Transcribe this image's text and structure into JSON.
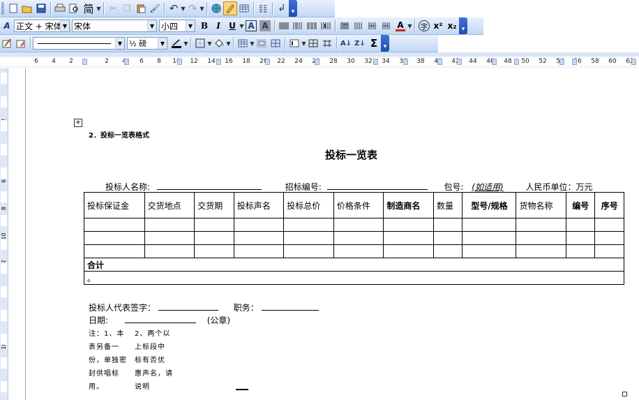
{
  "toolbar1": {
    "buttons": [
      "new-icon",
      "open-icon",
      "save-icon",
      "print-icon",
      "preview-icon"
    ],
    "simplified_label": "简",
    "hyperlink": "hyperlink-icon"
  },
  "toolbar2": {
    "style_value": "正文 + 宋体",
    "font_value": "宋体",
    "size_value": "小四",
    "bold": "B",
    "italic": "I",
    "underline": "U",
    "char_border": "A",
    "char_shading": "A",
    "font_color": "A",
    "enclose": "字",
    "superscript": "x²",
    "subscript": "x₂"
  },
  "toolbar3": {
    "line_weight_value": "½ 磅",
    "sum_label": "Σ"
  },
  "ruler": {
    "labels": [
      "6",
      "4",
      "2",
      "2",
      "4",
      "6",
      "8",
      "10",
      "12",
      "14",
      "16",
      "18",
      "20",
      "22",
      "24",
      "26",
      "28",
      "30",
      "32",
      "34",
      "36",
      "38",
      "40",
      "42",
      "44",
      "46",
      "48",
      "50",
      "52",
      "54",
      "56",
      "58",
      "60",
      "62"
    ],
    "vlabels": [
      "4",
      "2",
      "2",
      "4",
      "6",
      "8",
      "10",
      "12",
      "14",
      "16",
      "18"
    ]
  },
  "doc": {
    "section_heading": "2．投标一览表格式",
    "title": "投标一览表",
    "bidder_name_label": "投标人名称:",
    "tender_no_label": "招标编号:",
    "package_label": "包号:",
    "package_hint": "(如适用)",
    "currency_label": "人民币单位：万元",
    "columns": [
      "投标保证金",
      "交货地点",
      "交货期",
      "投标声名",
      "投标总价",
      "价格条件",
      "制造商名",
      "数量",
      "型号/规格",
      "货物名称",
      "编号",
      "序号"
    ],
    "empty_rows": 3,
    "total_label": "合计",
    "note_mark": "。",
    "rep_sign_label": "投标人代表签字：",
    "position_label": "职务：",
    "date_label": "日期:",
    "seal_label": "(公章)",
    "note_col1": [
      "注：1、本",
      "表另备一",
      "份，单独密",
      "封供唱标",
      "用。"
    ],
    "note_col2": [
      "2、两个以",
      "上标段中",
      "标有否优",
      "惠声名，请",
      "说明"
    ]
  }
}
